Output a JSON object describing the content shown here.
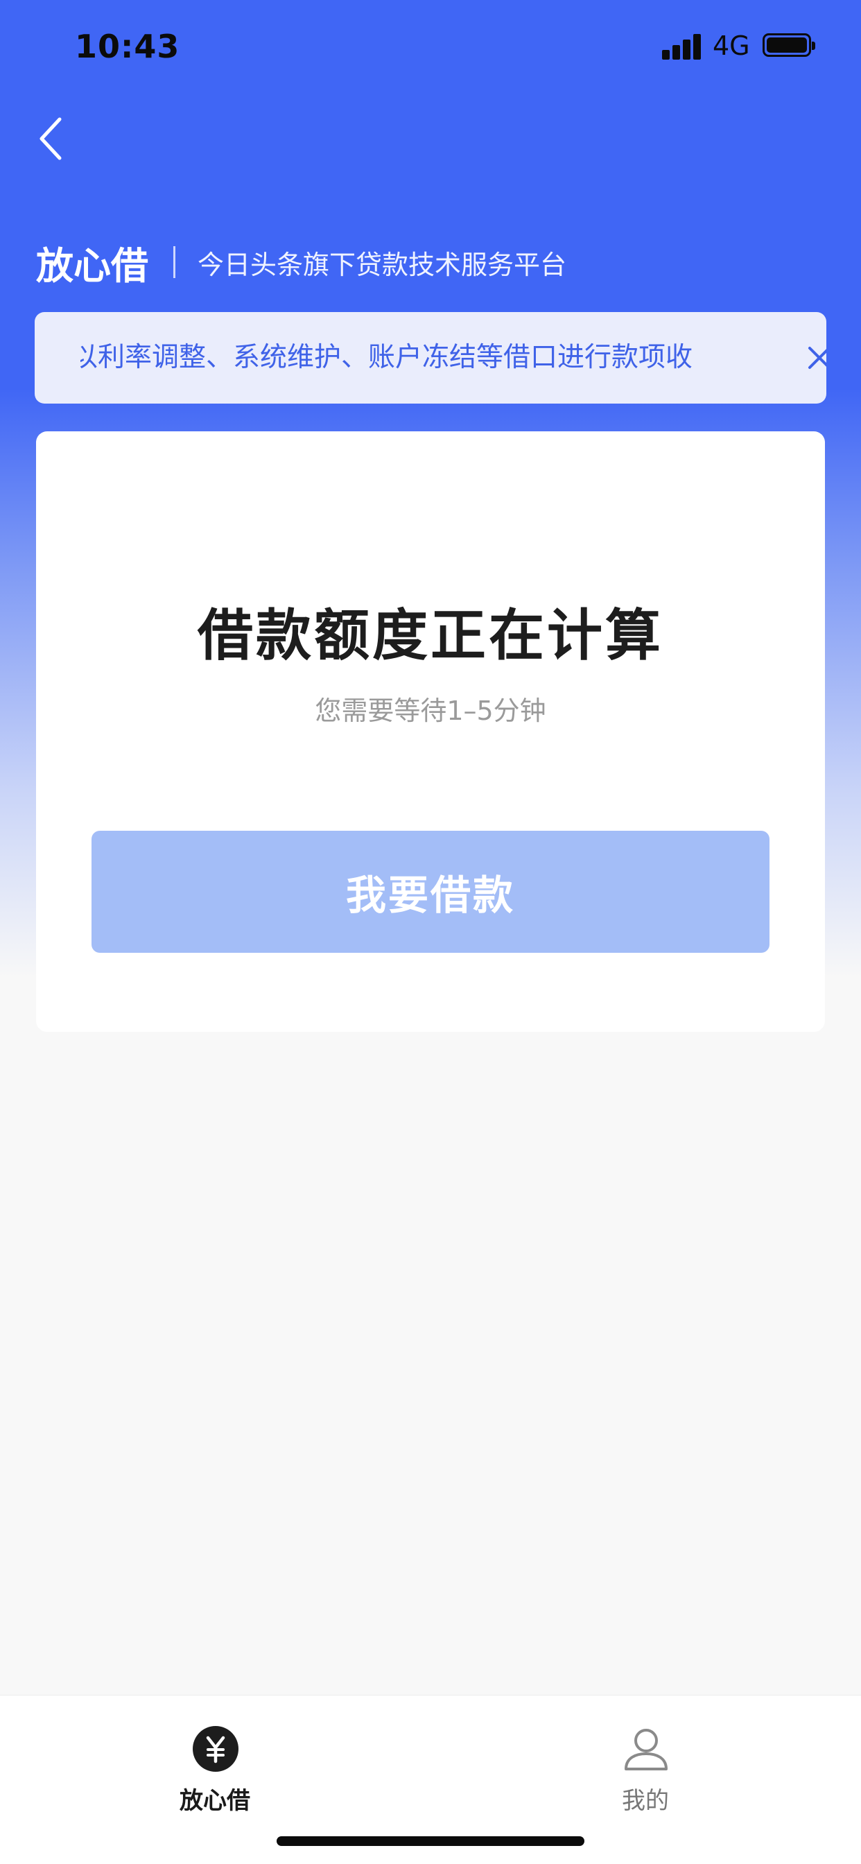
{
  "status_bar": {
    "time": "10:43",
    "network": "4G",
    "icons": [
      "signal-icon",
      "battery-icon"
    ]
  },
  "nav": {
    "back_icon": "chevron-left-icon"
  },
  "brand": {
    "name": "放心借",
    "tagline": "今日头条旗下贷款技术服务平台"
  },
  "notice": {
    "text": "以利率调整、系统维护、账户冻结等借口进行款项收",
    "close_icon": "close-icon"
  },
  "card": {
    "title": "借款额度正在计算",
    "subtitle": "您需要等待1–5分钟",
    "button_label": "我要借款"
  },
  "tab_bar": {
    "tabs": [
      {
        "label": "放心借",
        "icon": "yuan-icon",
        "active": true
      },
      {
        "label": "我的",
        "icon": "user-icon",
        "active": false
      }
    ]
  },
  "colors": {
    "primary": "#4066f5",
    "notice_bg": "#eaedfc",
    "notice_text": "#3f62e8",
    "button_disabled": "#a3bdf7"
  }
}
